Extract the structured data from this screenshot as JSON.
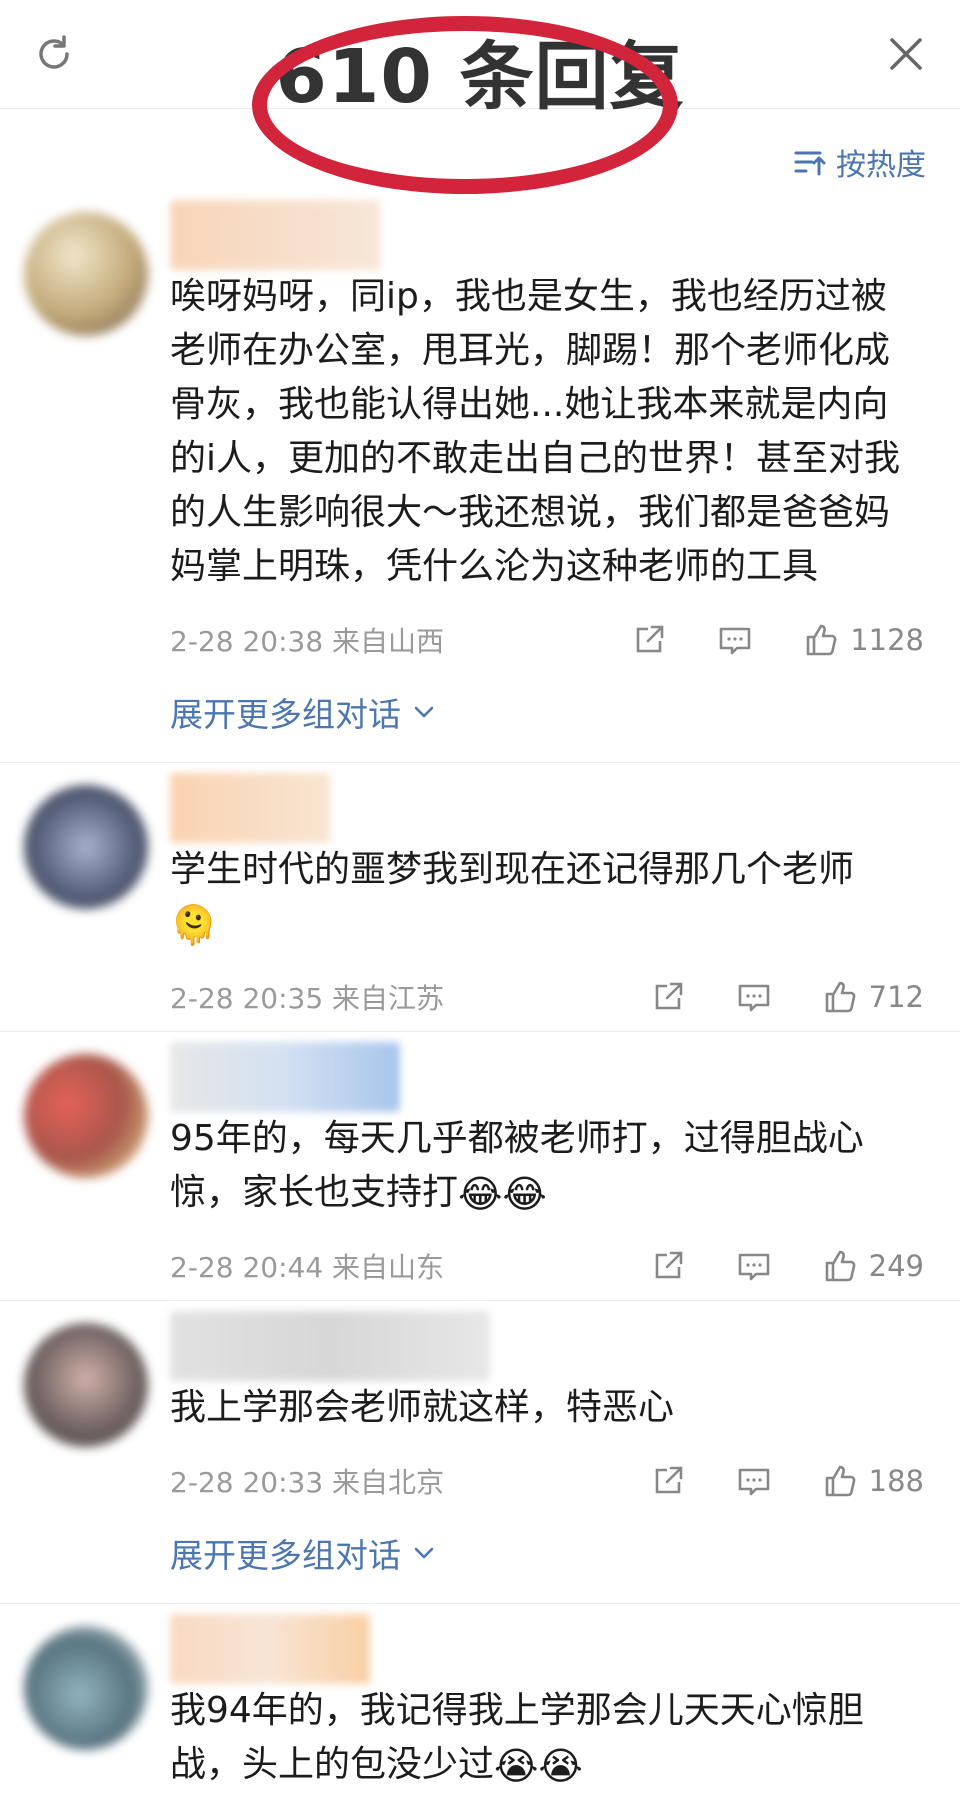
{
  "header": {
    "title": "610 条回复"
  },
  "sort": {
    "label": "按热度"
  },
  "comments": [
    {
      "text": "唉呀妈呀，同ip，我也是女生，我也经历过被老师在办公室，甩耳光，脚踢！那个老师化成骨灰，我也能认得出她...她让我本来就是内向的i人，更加的不敢走出自己的世界！甚至对我的人生影响很大～我还想说，我们都是爸爸妈妈掌上明珠，凭什么沦为这种老师的工具",
      "time": "2-28 20:38",
      "location": "来自山西",
      "likes": "1128",
      "expand": "展开更多组对话"
    },
    {
      "text": "学生时代的噩梦我到现在还记得那几个老师",
      "emoji": "🫠",
      "time": "2-28 20:35",
      "location": "来自江苏",
      "likes": "712"
    },
    {
      "text": "95年的，每天几乎都被老师打，过得胆战心惊，家长也支持打",
      "emoji": "😂😂",
      "time": "2-28 20:44",
      "location": "来自山东",
      "likes": "249"
    },
    {
      "text": "我上学那会老师就这样，特恶心",
      "time": "2-28 20:33",
      "location": "来自北京",
      "likes": "188",
      "expand": "展开更多组对话"
    },
    {
      "text": "我94年的，我记得我上学那会儿天天心惊胆战，头上的包没少过",
      "emoji": "😭😭"
    }
  ],
  "colors": {
    "accent": "#4c76b0",
    "ring": "#d2243a",
    "meta": "#9a9a9a"
  }
}
